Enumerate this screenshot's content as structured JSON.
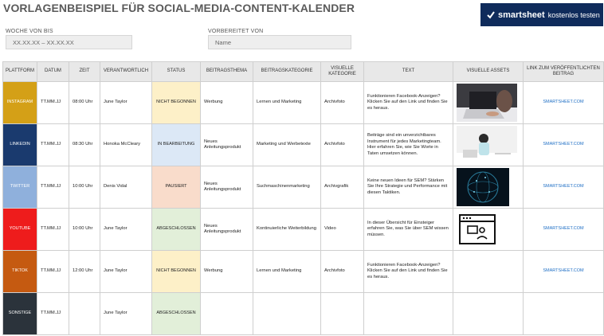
{
  "title": "VORLAGENBEISPIEL FÜR SOCIAL-MEDIA-CONTENT-KALENDER",
  "banner": {
    "brand": "smartsheet",
    "cta": "kostenlos testen"
  },
  "week": {
    "label": "WOCHE VON BIS",
    "value": "XX.XX.XX – XX.XX.XX"
  },
  "prepared": {
    "label": "VORBEREITET VON",
    "placeholder": "Name"
  },
  "headers": [
    "PLATTFORM",
    "DATUM",
    "ZEIT",
    "VERANTWORTLICH",
    "STATUS",
    "BEITRAGSTHEMA",
    "BEITRAGSKATEGORIE",
    "VISUELLE KATEGORIE",
    "TEXT",
    "VISUELLE ASSETS",
    "LINK ZUM VERÖFFENTLICHTEN BEITRAG"
  ],
  "rows": [
    {
      "platform": "INSTAGRAM",
      "platform_color": "#d4a017",
      "date": "TT.MM.JJ",
      "time": "08:00 Uhr",
      "owner": "June Taylor",
      "status": "NICHT BEGONNEN",
      "status_color": "#fdf0c8",
      "topic": "Werbung",
      "category": "Lernen und Marketing",
      "visual": "Archivfoto",
      "text": "Funktionieren Facebook-Anzeigen? Klicken Sie auf den Link und finden Sie es heraus.",
      "asset": "laptop-photo",
      "link": "SMARTSHEET.COM"
    },
    {
      "platform": "LINKEDIN",
      "platform_color": "#1a3a6e",
      "date": "TT.MM.JJ",
      "time": "08:30 Uhr",
      "owner": "Honoka McCleary",
      "status": "IN BEARBEITUNG",
      "status_color": "#dce8f6",
      "topic": "Neues Anleitungsprodukt",
      "category": "Marketing und Werbetexte",
      "visual": "Archivfoto",
      "text": "Beiträge sind ein unverzichtbares Instrument für jedes Marketingteam. Hier erfahren Sie, wie Sie Worte in Taten umsetzen können.",
      "asset": "woman-desk-photo",
      "link": "SMARTSHEET.COM"
    },
    {
      "platform": "TWITTER",
      "platform_color": "#8fb0dc",
      "date": "TT.MM.JJ",
      "time": "10:00 Uhr",
      "owner": "Denis Vidal",
      "status": "PAUSIERT",
      "status_color": "#f9dccb",
      "topic": "Neues Anleitungsprodukt",
      "category": "Suchmaschinenmarketing",
      "visual": "Archivgrafik",
      "text": "Keine neuen Ideen für SEM? Stärken Sie Ihre Strategie und Performance mit diesen Taktiken.",
      "asset": "globe-graphic",
      "link": "SMARTSHEET.COM"
    },
    {
      "platform": "YOUTUBE",
      "platform_color": "#ee1c1c",
      "date": "TT.MM.JJ",
      "time": "10:00 Uhr",
      "owner": "June Taylor",
      "status": "ABGESCHLOSSEN",
      "status_color": "#e2efd9",
      "topic": "Neues Anleitungsprodukt",
      "category": "Kontinuierliche Weiterbildung",
      "visual": "Video",
      "text": "In dieser Übersicht für Einsteiger erfahren Sie, was Sie über SEM wissen müssen.",
      "asset": "video-icon",
      "link": "SMARTSHEET.COM"
    },
    {
      "platform": "TIKTOK",
      "platform_color": "#c55a11",
      "date": "TT.MM.JJ",
      "time": "12:00 Uhr",
      "owner": "June Taylor",
      "status": "NICHT BEGONNEN",
      "status_color": "#fdf0c8",
      "topic": "Werbung",
      "category": "Lernen und Marketing",
      "visual": "Archivfoto",
      "text": "Funktionieren Facebook-Anzeigen? Klicken Sie auf den Link und finden Sie es heraus.",
      "asset": "",
      "link": "SMARTSHEET.COM"
    },
    {
      "platform": "SONSTIGE",
      "platform_color": "#2b333b",
      "date": "TT.MM.JJ",
      "time": "",
      "owner": "June Taylor",
      "status": "ABGESCHLOSSEN",
      "status_color": "#e2efd9",
      "topic": "",
      "category": "",
      "visual": "",
      "text": "",
      "asset": "",
      "link": ""
    }
  ]
}
